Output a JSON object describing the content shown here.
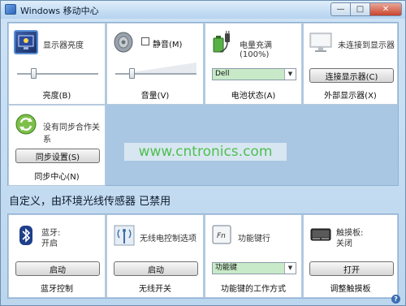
{
  "window": {
    "title": "Windows 移动中心",
    "minimize_glyph": "—",
    "maximize_glyph": "□",
    "close_glyph": "✕"
  },
  "tiles_top": {
    "display": {
      "title": "显示器亮度",
      "label": "亮度(B)",
      "brightness_percent": 20
    },
    "volume": {
      "mute_label": "静音(M)",
      "mute_checked": false,
      "label": "音量(V)",
      "volume_percent": 20
    },
    "battery": {
      "title": "电量充满(100%)",
      "plan_value": "Dell",
      "label": "电池状态(A)",
      "charge_percent": 100
    },
    "external_display": {
      "title": "未连接到显示器",
      "button_label": "连接显示器(C)",
      "label": "外部显示器(X)"
    },
    "sync": {
      "title": "没有同步合作关系",
      "button_label": "同步设置(S)",
      "label": "同步中心(N)"
    }
  },
  "watermark": "www.cntronics.com",
  "section_heading": "自定义，由环境光线传感器 已禁用",
  "tiles_bottom": {
    "bluetooth": {
      "title": "蓝牙:",
      "status": "开启",
      "button_label": "启动",
      "label": "蓝牙控制"
    },
    "wireless": {
      "title": "无线电控制选项",
      "button_label": "启动",
      "label": "无线开关"
    },
    "fn_key": {
      "title": "功能键行",
      "select_value": "功能键",
      "label": "功能键的工作方式",
      "icon_text": "Fn"
    },
    "touchpad": {
      "title": "触摸板:",
      "status": "关闭",
      "button_label": "打开",
      "label": "调整触摸板"
    }
  },
  "help_glyph": "?",
  "colors": {
    "accent": "#2f66b8",
    "select_bg": "#c8eac8",
    "watermark": "#4fbf4f"
  }
}
